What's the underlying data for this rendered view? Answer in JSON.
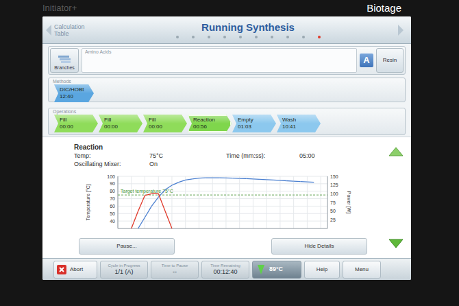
{
  "device": {
    "model": "Initiator+",
    "brand": "Biotage"
  },
  "header": {
    "back": "Calculation Table",
    "title": "Running Synthesis",
    "pages": [
      {
        "selected": false
      },
      {
        "selected": false
      },
      {
        "selected": false
      },
      {
        "selected": false
      },
      {
        "selected": false
      },
      {
        "selected": false
      },
      {
        "selected": false
      },
      {
        "selected": false
      },
      {
        "selected": false
      },
      {
        "selected": true
      }
    ]
  },
  "amino_acids": {
    "label": "Amino Acids",
    "branches": "Branches",
    "sequence_button": "A",
    "resin": "Resin"
  },
  "methods": {
    "label": "Methods",
    "items": [
      {
        "name": "DIC/HOBt",
        "time": "12:40",
        "color": "#5aa6e0"
      }
    ]
  },
  "operations": {
    "label": "Operations",
    "items": [
      {
        "name": "Fill",
        "time": "00:00",
        "color": "#8fdc5a",
        "selected": false
      },
      {
        "name": "Fill",
        "time": "00:00",
        "color": "#8fdc5a",
        "selected": false
      },
      {
        "name": "Fill",
        "time": "00:00",
        "color": "#8fdc5a",
        "selected": false
      },
      {
        "name": "Reaction",
        "time": "00:56",
        "color": "#7fd64c",
        "selected": true
      },
      {
        "name": "Empty",
        "time": "01:03",
        "color": "#8cc8ee",
        "selected": false
      },
      {
        "name": "Wash",
        "time": "10:41",
        "color": "#8cc8ee",
        "selected": false
      }
    ]
  },
  "details": {
    "title": "Reaction",
    "fields": [
      {
        "label": "Temp:",
        "value": "75°C"
      },
      {
        "label": "Time (mm:ss):",
        "value": "05:00"
      },
      {
        "label": "Oscillating Mixer:",
        "value": "On"
      }
    ]
  },
  "chart": {
    "left_axis": {
      "title": "Temperature [°C]",
      "ticks": [
        "100",
        "90",
        "80",
        "70",
        "60",
        "50",
        "40"
      ]
    },
    "right_axis": {
      "title": "Power [W]",
      "ticks": [
        "150",
        "125",
        "100",
        "75",
        "50",
        "25"
      ]
    },
    "target": {
      "label": "Target temperature 75°C",
      "value": 75
    },
    "series": [
      {
        "axis": "left",
        "color": "#4a7fd0",
        "values": [
          null,
          null,
          null,
          30,
          45,
          60,
          72,
          82,
          88,
          92,
          95,
          96.5,
          97.5,
          98,
          98,
          98,
          97.8,
          97.5,
          97.2,
          97,
          96.5,
          96,
          95.5,
          95,
          94.5,
          94,
          93.5,
          93,
          92.5,
          92
        ]
      },
      {
        "axis": "right",
        "color": "#e0392a",
        "values": [
          null,
          null,
          0,
          50,
          95,
          100,
          100,
          50,
          0
        ]
      }
    ]
  },
  "buttons": [
    "Pause...",
    "Hide Details"
  ],
  "status_bar": {
    "abort": "Abort",
    "fields": [
      {
        "label": "Cycle in Progress",
        "value": "1/1 (A)"
      },
      {
        "label": "Time to Pause",
        "value": "--"
      },
      {
        "label": "Time Remaining",
        "value": "00:12:40"
      }
    ],
    "temperature": "89°C",
    "help": "Help",
    "menu": "Menu"
  }
}
